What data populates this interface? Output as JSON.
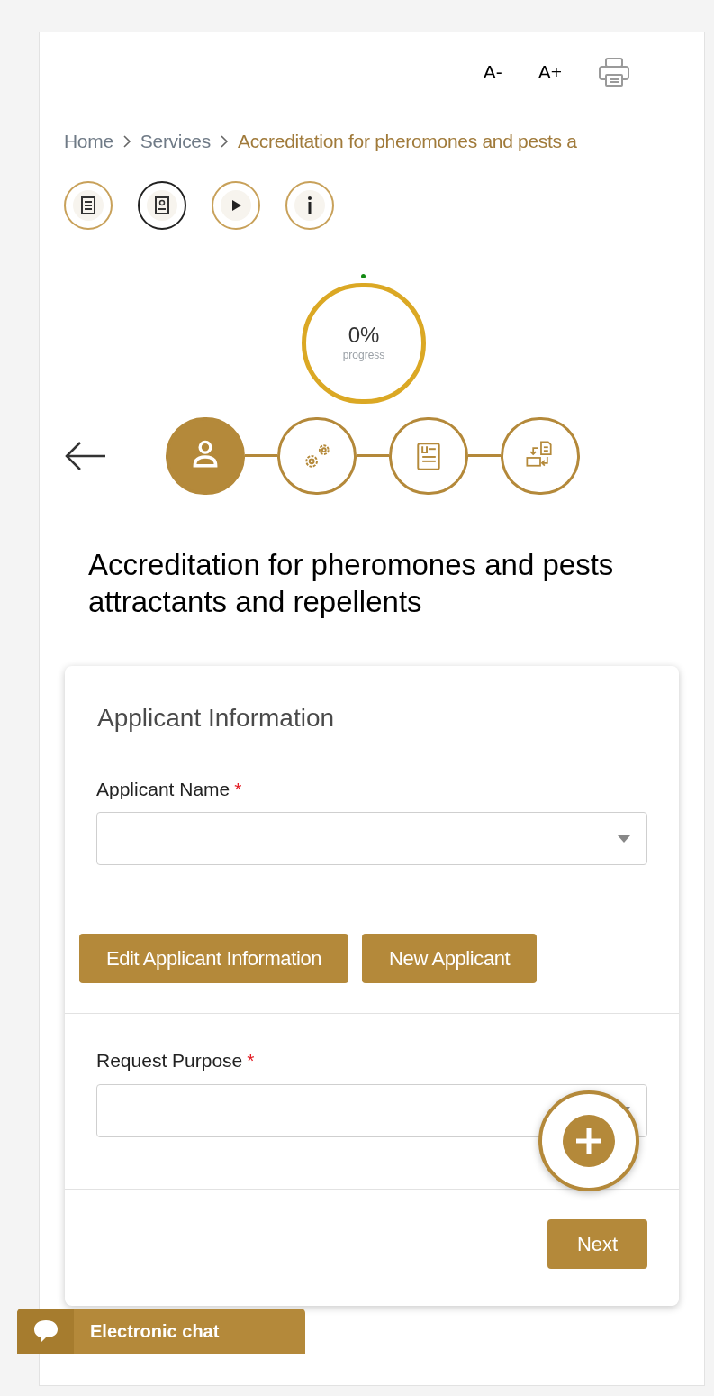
{
  "toolbar": {
    "font_decrease": "A-",
    "font_increase": "A+"
  },
  "breadcrumb": [
    {
      "label": "Home",
      "current": false
    },
    {
      "label": "Services",
      "current": false
    },
    {
      "label": "Accreditation for pheromones and pests a",
      "current": true
    }
  ],
  "service_icons": [
    {
      "kind": "document",
      "selected": false
    },
    {
      "kind": "card",
      "selected": true
    },
    {
      "kind": "video",
      "selected": false
    },
    {
      "kind": "info",
      "selected": false
    }
  ],
  "progress": {
    "value": "0%",
    "label": "progress"
  },
  "steps": [
    {
      "kind": "applicant",
      "selected": true
    },
    {
      "kind": "settings",
      "selected": false
    },
    {
      "kind": "form",
      "selected": false
    },
    {
      "kind": "exchange",
      "selected": false
    }
  ],
  "title": "Accreditation for pheromones and pests attractants and repellents",
  "card": {
    "heading": "Applicant Information",
    "applicant_field": {
      "label": "Applicant Name",
      "required_mark": "*"
    },
    "buttons": [
      "Edit Applicant Information",
      "New Applicant"
    ],
    "purpose_field": {
      "label": "Request Purpose",
      "required_mark": "*"
    },
    "next_button": "Next"
  },
  "chat": {
    "label": "Electronic chat"
  }
}
